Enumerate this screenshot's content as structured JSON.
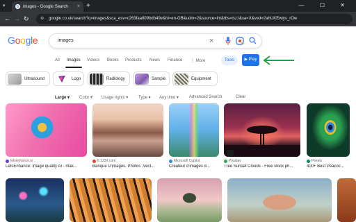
{
  "browser": {
    "tab_title": "images - Google Search",
    "tab_close": "×",
    "new_tab": "+",
    "url": "google.co.uk/search?q=images&sca_esv=c263faa809bdb49e&hl=en-GB&udm=2&source=lnt&tbs=isz:l&sa=X&ved=2ahUKEwiys_rOw",
    "window_controls": "— ☐ ✕"
  },
  "header": {
    "logo_letters": [
      "G",
      "o",
      "o",
      "g",
      "l",
      "e"
    ],
    "query": "images",
    "clear_icon": "×"
  },
  "nav": {
    "items": [
      "All",
      "Images",
      "Videos",
      "Books",
      "Products",
      "News",
      "Finance",
      "⋮ More"
    ],
    "active": "Images",
    "tools_label": "Tools",
    "play_label": "▶ Play",
    "arrow_color": "#1ea446"
  },
  "chips": [
    {
      "label": "Ultrasound",
      "color": "#c9c9c9"
    },
    {
      "label": "Logo",
      "color": "#7a3aa8"
    },
    {
      "label": "Radiology",
      "color": "#3c3c3c"
    },
    {
      "label": "Sample",
      "color": "#a383c8"
    },
    {
      "label": "Equipment",
      "color": "#8a8a7a"
    }
  ],
  "filters": {
    "large": "Large",
    "color": "Color",
    "usage_rights": "Usage rights",
    "type": "Type",
    "any_time": "Any time",
    "advanced": "Advanced Search",
    "clear": "Clear"
  },
  "results_row1": [
    {
      "source": "letsenhance.io",
      "title": "LetsEnhance: Image quality AI - mak...",
      "color": "#6fbf3a"
    },
    {
      "source": "fr.123rf.com",
      "title": "Banque D'images, Photos ,Vect...",
      "color": "#b07a5a"
    },
    {
      "source": "Microsoft Copilot",
      "title": "Créateur d'images d...",
      "color": "#60a0e0"
    },
    {
      "source": "Pixabay",
      "title": "Tree Sunset Clouds - Free stock ph...",
      "color": "#3a2440"
    },
    {
      "source": "Pexels",
      "title": "400+ Best Peacoc...",
      "color": "#1f6e5a"
    }
  ]
}
